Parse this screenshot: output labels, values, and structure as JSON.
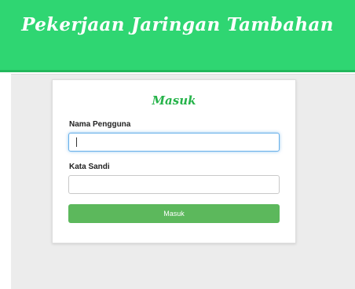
{
  "header": {
    "title": "Pekerjaan Jaringan Tambahan"
  },
  "login": {
    "title": "Masuk",
    "username_label": "Nama Pengguna",
    "username_value": "",
    "password_label": "Kata Sandi",
    "password_value": "",
    "submit_label": "Masuk"
  },
  "colors": {
    "header_bg": "#2fd672",
    "accent_green": "#26b34a",
    "button_bg": "#5cb85c",
    "focus_border": "#66afe9"
  }
}
